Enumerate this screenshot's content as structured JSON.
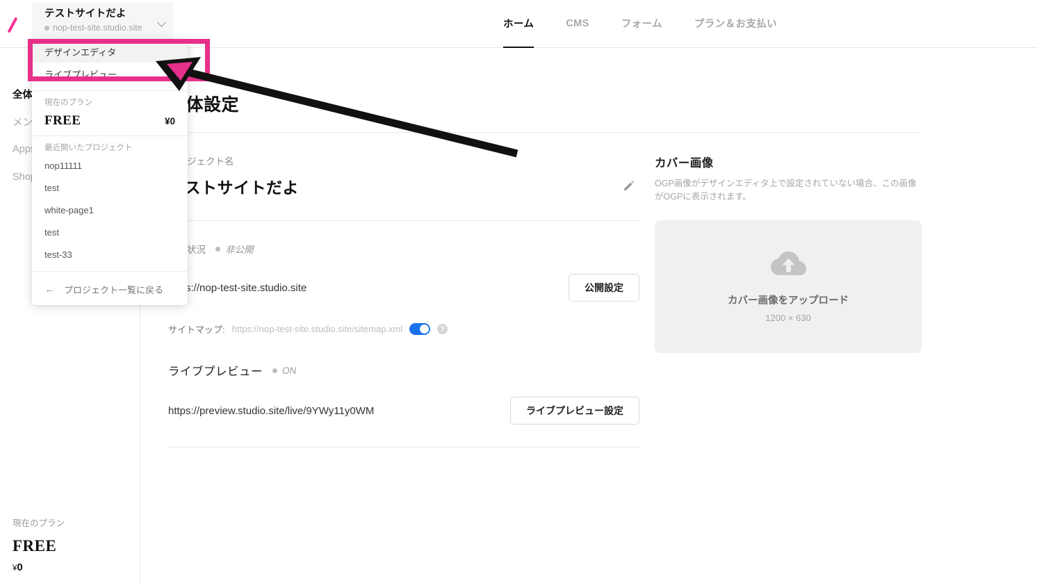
{
  "header": {
    "logo_icon": "studio-slash-logo-icon",
    "site_name": "テストサイトだよ",
    "site_domain": "nop-test-site.studio.site",
    "chevron_icon": "chevron-down-icon",
    "tabs": [
      {
        "label": "ホーム",
        "active": true
      },
      {
        "label": "CMS",
        "active": false
      },
      {
        "label": "フォーム",
        "active": false
      },
      {
        "label": "プラン＆お支払い",
        "active": false
      }
    ]
  },
  "sidebar": {
    "items": [
      {
        "label": "全体設定",
        "active": true
      },
      {
        "label": "メンバー",
        "active": false
      },
      {
        "label": "Apps",
        "active": false
      },
      {
        "label": "Shop",
        "active": false
      }
    ],
    "plan_label": "現在のプラン",
    "plan_name": "FREE",
    "plan_price_symbol": "¥",
    "plan_price": "0"
  },
  "dropdown": {
    "items": [
      {
        "label": "デザインエディタ",
        "hover": true
      },
      {
        "label": "ライブプレビュー",
        "hover": false
      }
    ],
    "plan_section_label": "現在のプラン",
    "plan_name": "FREE",
    "plan_price": "¥0",
    "recent_label": "最近開いたプロジェクト",
    "recent_projects": [
      "nop11111",
      "test",
      "white-page1",
      "test",
      "test-33"
    ],
    "back_icon": "arrow-left-icon",
    "back_label": "プロジェクト一覧に戻る"
  },
  "main": {
    "page_title": "全体設定",
    "project_name_label": "プロジェクト名",
    "project_name": "テストサイトだよ",
    "edit_icon": "pencil-icon",
    "publish_label": "公開状況",
    "publish_status": "非公開",
    "site_url": "https://nop-test-site.studio.site",
    "publish_settings_button": "公開設定",
    "sitemap_label": "サイトマップ:",
    "sitemap_url": "https://nop-test-site.studio.site/sitemap.xml",
    "sitemap_toggle_on": true,
    "help_icon": "question-mark-icon",
    "live_preview_title": "ライブプレビュー",
    "live_preview_status": "ON",
    "live_preview_url": "https://preview.studio.site/live/9YWy11y0WM",
    "live_preview_button": "ライブプレビュー設定"
  },
  "cover": {
    "title": "カバー画像",
    "description": "OGP画像がデザインエディタ上で設定されていない場合、この画像がOGPに表示されます。",
    "upload_icon": "cloud-upload-icon",
    "upload_label": "カバー画像をアップロード",
    "dimensions": "1200 × 630"
  },
  "annotations": {
    "highlight_color": "#e6308a",
    "arrow_color": "#111111",
    "highlight_target": "デザインエディタ"
  }
}
